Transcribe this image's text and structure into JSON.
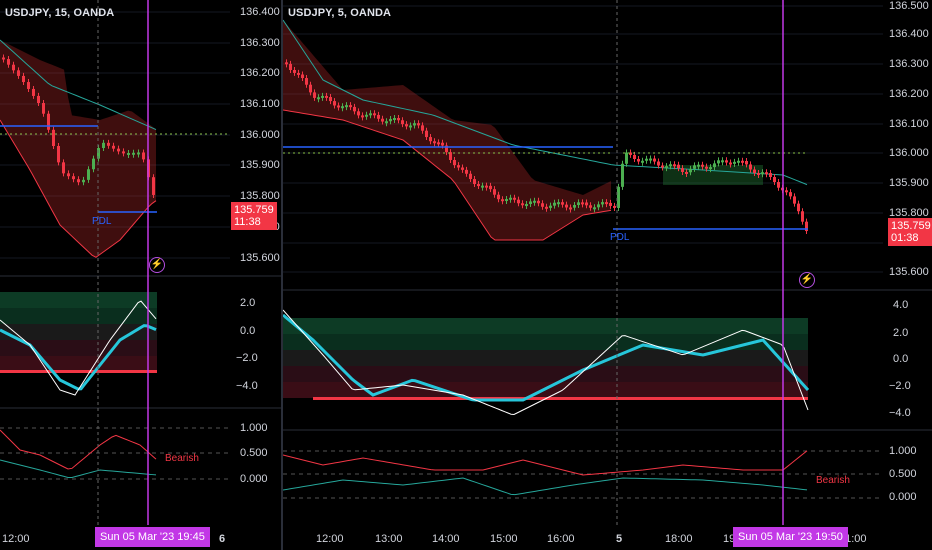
{
  "left_chart": {
    "title": "USDJPY, 15, OANDA",
    "price_axis": [
      "136.400",
      "136.300",
      "136.200",
      "136.100",
      "136.000",
      "135.900",
      "135.800",
      "135.700",
      "135.600"
    ],
    "last_price": "135.759",
    "countdown": "11:38",
    "pdl_label": "PDL",
    "osc_axis": [
      "2.0",
      "0.0",
      "−2.0",
      "−4.0"
    ],
    "sentiment_axis": [
      "1.000",
      "0.500",
      "0.000"
    ],
    "sentiment_label": "Bearish",
    "time_labels": [
      "12:00",
      "6"
    ],
    "cursor_time": "Sun 05 Mar '23   19:45"
  },
  "right_chart": {
    "title": "USDJPY, 5, OANDA",
    "price_axis": [
      "136.500",
      "136.400",
      "136.300",
      "136.200",
      "136.100",
      "136.000",
      "135.900",
      "135.800",
      "135.700",
      "135.600"
    ],
    "last_price": "135.759",
    "countdown": "01:38",
    "pdl_label": "PDL",
    "osc_axis": [
      "4.0",
      "2.0",
      "0.0",
      "−2.0",
      "−4.0"
    ],
    "sentiment_axis": [
      "1.000",
      "0.500",
      "0.000"
    ],
    "sentiment_label": "Bearish",
    "time_labels": [
      "12:00",
      "13:00",
      "14:00",
      "15:00",
      "16:00",
      "5",
      "18:00",
      "19",
      "21:00"
    ],
    "cursor_time": "Sun 05 Mar '23   19:50"
  },
  "colors": {
    "bull": "#4caf50",
    "bear": "#f23645",
    "cyan": "#26c6da",
    "blue_line": "#2962ff",
    "cursor": "#c238e6",
    "green_dotted": "#8bc34a"
  },
  "icons": [
    "lightning-icon"
  ]
}
